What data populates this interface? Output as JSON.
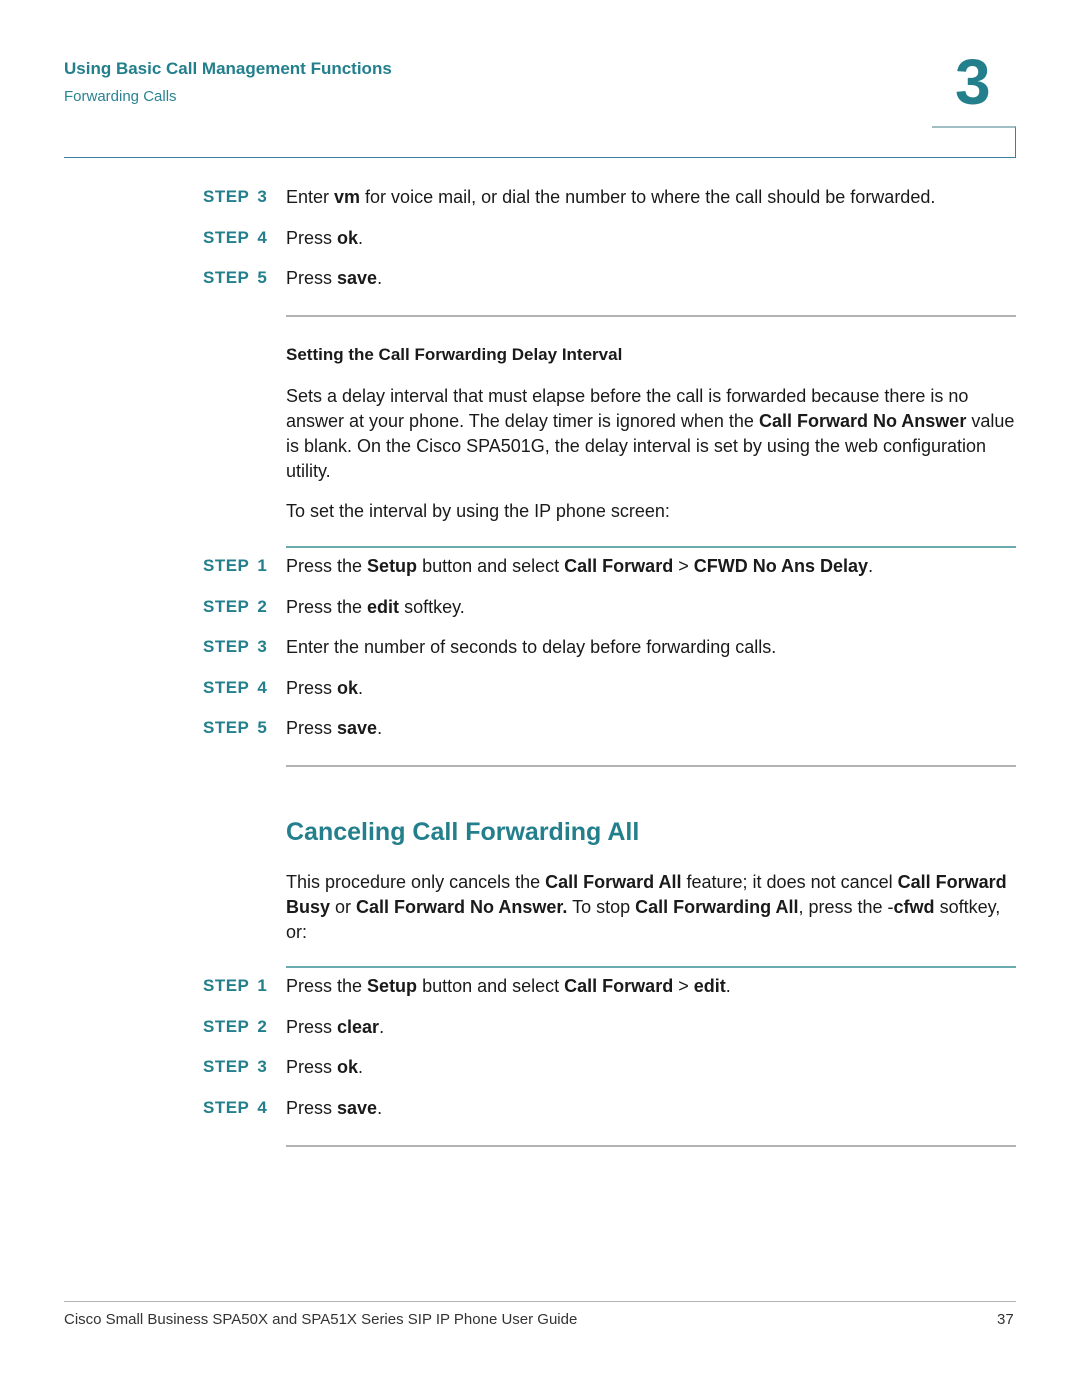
{
  "header": {
    "chapter_title": "Using Basic Call Management Functions",
    "section": "Forwarding Calls",
    "chapter_number": "3"
  },
  "step_word": "STEP",
  "intro_steps": [
    {
      "num": "3",
      "parts": [
        [
          "Enter ",
          false
        ],
        [
          "vm",
          true
        ],
        [
          " for voice mail, or dial the number to where the call should be forwarded.",
          false
        ]
      ]
    },
    {
      "num": "4",
      "parts": [
        [
          "Press ",
          false
        ],
        [
          "ok",
          true
        ],
        [
          ".",
          false
        ]
      ]
    },
    {
      "num": "5",
      "parts": [
        [
          "Press ",
          false
        ],
        [
          "save",
          true
        ],
        [
          ".",
          false
        ]
      ]
    }
  ],
  "delay_section": {
    "heading": "Setting the Call Forwarding Delay Interval",
    "paragraph": [
      [
        "Sets a delay interval that must elapse before the call is forwarded because there is no answer at your phone. The delay timer is ignored when the ",
        false
      ],
      [
        "Call Forward No Answer",
        true
      ],
      [
        " value is blank. On the Cisco SPA501G, the delay interval is set by using the web configuration utility.",
        false
      ]
    ],
    "lead_in": "To set the interval by using the IP phone screen:",
    "steps": [
      {
        "num": "1",
        "parts": [
          [
            "Press the ",
            false
          ],
          [
            "Setup",
            true
          ],
          [
            " button and select ",
            false
          ],
          [
            "Call Forward",
            true
          ],
          [
            " > ",
            false
          ],
          [
            "CFWD No Ans Delay",
            true
          ],
          [
            ".",
            false
          ]
        ]
      },
      {
        "num": "2",
        "parts": [
          [
            "Press the ",
            false
          ],
          [
            "edit",
            true
          ],
          [
            " softkey.",
            false
          ]
        ]
      },
      {
        "num": "3",
        "parts": [
          [
            "Enter the number of seconds to delay before forwarding calls.",
            false
          ]
        ]
      },
      {
        "num": "4",
        "parts": [
          [
            "Press ",
            false
          ],
          [
            "ok",
            true
          ],
          [
            ".",
            false
          ]
        ]
      },
      {
        "num": "5",
        "parts": [
          [
            "Press ",
            false
          ],
          [
            "save",
            true
          ],
          [
            ".",
            false
          ]
        ]
      }
    ]
  },
  "cancel_section": {
    "heading": "Canceling Call Forwarding All",
    "paragraph": [
      [
        "This procedure only cancels the ",
        false
      ],
      [
        "Call Forward All",
        true
      ],
      [
        " feature; it does not cancel ",
        false
      ],
      [
        "Call Forward Busy",
        true
      ],
      [
        " or ",
        false
      ],
      [
        "Call Forward No Answer.",
        true
      ],
      [
        " To stop ",
        false
      ],
      [
        "Call Forwarding All",
        true
      ],
      [
        ", press the -",
        false
      ],
      [
        "cfwd",
        true
      ],
      [
        " softkey, or:",
        false
      ]
    ],
    "steps": [
      {
        "num": "1",
        "parts": [
          [
            "Press the ",
            false
          ],
          [
            "Setup",
            true
          ],
          [
            " button and select ",
            false
          ],
          [
            "Call Forward",
            true
          ],
          [
            " > ",
            false
          ],
          [
            "edit",
            true
          ],
          [
            ".",
            false
          ]
        ]
      },
      {
        "num": "2",
        "parts": [
          [
            "Press ",
            false
          ],
          [
            "clear",
            true
          ],
          [
            ".",
            false
          ]
        ]
      },
      {
        "num": "3",
        "parts": [
          [
            "Press ",
            false
          ],
          [
            "ok",
            true
          ],
          [
            ".",
            false
          ]
        ]
      },
      {
        "num": "4",
        "parts": [
          [
            "Press ",
            false
          ],
          [
            "save",
            true
          ],
          [
            ".",
            false
          ]
        ]
      }
    ]
  },
  "footer": {
    "guide_title": "Cisco Small Business SPA50X and SPA51X Series SIP IP Phone User Guide",
    "page_number": "37"
  }
}
